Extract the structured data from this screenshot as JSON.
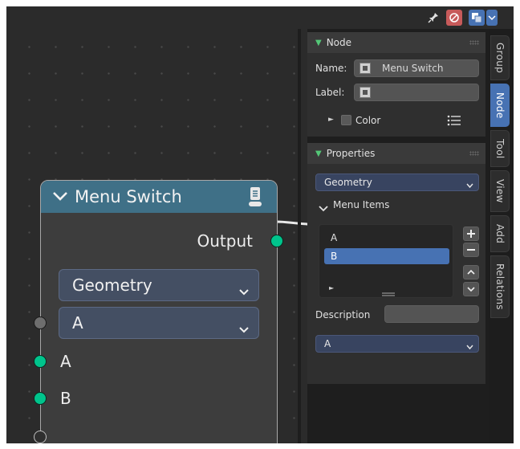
{
  "node": {
    "title": "Menu Switch",
    "output_label": "Output",
    "mode_value": "Geometry",
    "menu_value": "A",
    "inputs": [
      "A",
      "B"
    ]
  },
  "sidebar": {
    "node_panel": {
      "title": "Node",
      "name_label": "Name:",
      "name_value": "Menu Switch",
      "label_label": "Label:",
      "label_value": "",
      "color_label": "Color"
    },
    "properties_panel": {
      "title": "Properties",
      "mode_value": "Geometry",
      "menu_items_label": "Menu Items",
      "items": [
        "A",
        "B"
      ],
      "selected_item": "B",
      "description_label": "Description",
      "description_value": "",
      "default_value": "A"
    }
  },
  "tabs": [
    "Group",
    "Node",
    "Tool",
    "View",
    "Add",
    "Relations"
  ],
  "active_tab": "Node",
  "colors": {
    "node_header": "#3f7087",
    "socket_green": "#00c48c",
    "accent_blue": "#4772b3",
    "dropdown_blue": "#444f63",
    "panel_arrow_green": "#54c777"
  }
}
